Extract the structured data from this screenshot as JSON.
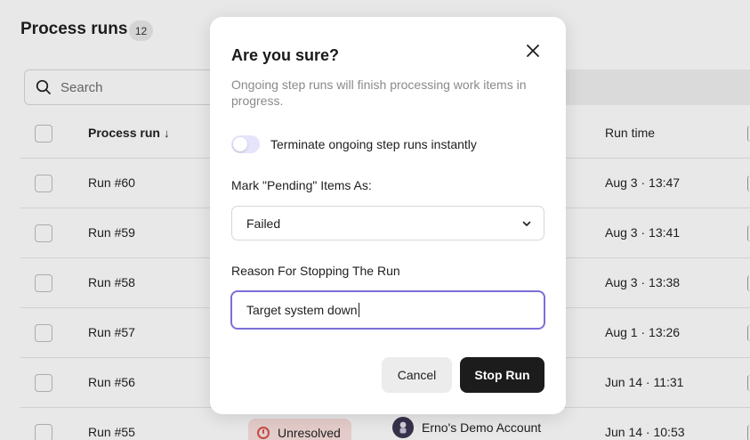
{
  "page": {
    "title": "Process runs",
    "count": "12",
    "search_placeholder": "Search"
  },
  "table": {
    "headers": {
      "name": "Process run",
      "run_time": "Run time"
    },
    "rows": [
      {
        "name": "Run #60",
        "run_time": "Aug 3 · 13:47"
      },
      {
        "name": "Run #59",
        "run_time": "Aug 3 · 13:41"
      },
      {
        "name": "Run #58",
        "run_time": "Aug 3 · 13:38"
      },
      {
        "name": "Run #57",
        "run_time": "Aug 1 · 13:26"
      },
      {
        "name": "Run #56",
        "run_time": "Jun 14 · 11:31"
      },
      {
        "name": "Run #55",
        "run_time": "Jun 14 · 10:53",
        "status": "Unresolved",
        "account": "Erno's Demo Account"
      }
    ]
  },
  "modal": {
    "title": "Are you sure?",
    "description": "Ongoing step runs will finish processing work items in progress.",
    "toggle_label": "Terminate ongoing step runs instantly",
    "toggle_on": false,
    "pending_label": "Mark \"Pending\" Items As:",
    "pending_value": "Failed",
    "reason_label": "Reason For Stopping The Run",
    "reason_value": "Target system down",
    "cancel_label": "Cancel",
    "stop_label": "Stop Run"
  },
  "colors": {
    "accent": "#7b6fd6",
    "primary_button": "#1c1c1c",
    "status_unresolved_bg": "#fbe0de",
    "status_unresolved_icon": "#d9504a",
    "toggle_off": "#e6e4fb"
  },
  "icons": {
    "search": "search-icon",
    "close": "close-icon",
    "chevron": "chevron-down-icon",
    "sort": "arrow-down-icon",
    "status": "alert-circle-icon"
  }
}
